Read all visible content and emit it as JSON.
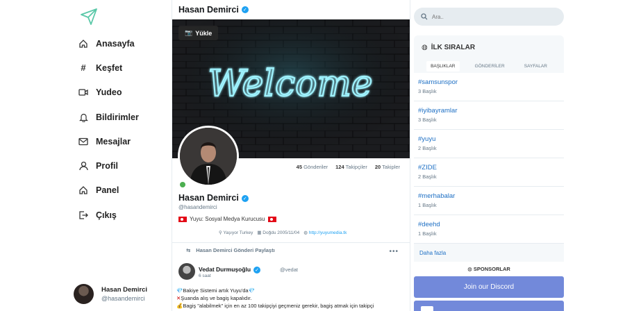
{
  "colors": {
    "accent": "#1da1f2",
    "link": "#1d6fc4",
    "discord": "#7289da",
    "online": "#4caf50"
  },
  "sidebar": {
    "logo_icon": "paper-plane-icon",
    "items": [
      {
        "label": "Anasayfa",
        "icon": "home-icon"
      },
      {
        "label": "Keşfet",
        "icon": "hash-icon"
      },
      {
        "label": "Yudeo",
        "icon": "video-icon"
      },
      {
        "label": "Bildirimler",
        "icon": "bell-icon"
      },
      {
        "label": "Mesajlar",
        "icon": "mail-icon"
      },
      {
        "label": "Profil",
        "icon": "user-icon"
      },
      {
        "label": "Panel",
        "icon": "home-icon"
      },
      {
        "label": "Çıkış",
        "icon": "logout-icon"
      }
    ],
    "me": {
      "name": "Hasan Demirci",
      "handle": "@hasandemirci"
    }
  },
  "profile": {
    "header_title": "Hasan Demirci",
    "upload_label": "Yükle",
    "cover_text": "Welcome",
    "stats": [
      {
        "value": "45",
        "label": "Gönderiler"
      },
      {
        "value": "124",
        "label": "Takipçiler"
      },
      {
        "value": "20",
        "label": "Takipler"
      }
    ],
    "name": "Hasan Demirci",
    "handle": "@hasandemirci",
    "bio": "Yuyu: Sosyal Medya Kurucusu",
    "location": "Yaşıyor Turkey",
    "birth": "Doğdu 2005/11/04",
    "website": "http://yuyumedia.tk"
  },
  "post": {
    "repost_label": "Hasan Demirci Gönderi Paylaştı",
    "more": "•••",
    "author": "Vedat Durmuşoğlu",
    "handle": "@vedat",
    "time": "6 saat",
    "lines": [
      "Bakiye Sistemi artık Yuyu'da",
      "Şuanda alış ve bagiş kapalıdır.",
      "Bagiş \"alabilmek\" için en az 100 takipçiyi geçmeniz gerekir, bagiş atmak için takipçi"
    ]
  },
  "search": {
    "placeholder": "Ara.."
  },
  "trends": {
    "title": "İLK SIRALAR",
    "tabs": [
      "BAŞLIKLAR",
      "GÖNDERİLER",
      "SAYFALAR"
    ],
    "items": [
      {
        "tag": "#samsunspor",
        "count": "3 Başlık"
      },
      {
        "tag": "#iyibayramlar",
        "count": "3 Başlık"
      },
      {
        "tag": "#yuyu",
        "count": "2 Başlık"
      },
      {
        "tag": "#ZIDE",
        "count": "2 Başlık"
      },
      {
        "tag": "#merhabalar",
        "count": "1 Başlık"
      },
      {
        "tag": "#deehd",
        "count": "1 Başlık"
      }
    ],
    "more": "Daha fazla"
  },
  "sponsors": {
    "title": "SPONSORLAR",
    "discord_label": "Join our Discord"
  }
}
